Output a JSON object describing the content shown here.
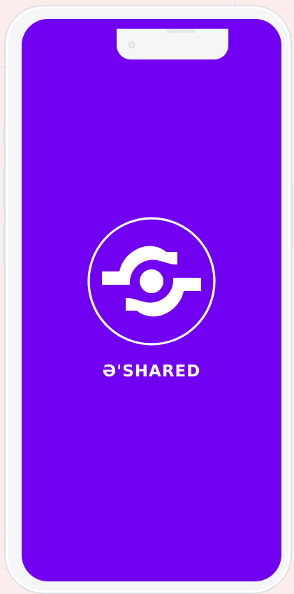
{
  "app": {
    "brand_name": "Ә'SHARED"
  },
  "splash": {
    "background_color": "#7100f2",
    "logo_icon": "shared-sync-logo-icon"
  },
  "device": {
    "frame_color": "#f4f6f7"
  }
}
